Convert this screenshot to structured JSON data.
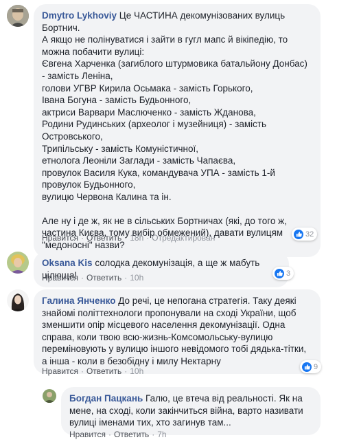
{
  "comments": [
    {
      "author": "Dmytro Lykhoviy",
      "paragraphs": [
        "Це ЧАСТИНА декомунізованих вулиць Бортнич.\nА якщо не полінуватися і зайти в гугл мапс й вікіпедію, то можна побачити вулиці:\nЄвгена Харченка (загиблого штурмовика батальйону Донбас) - замість Леніна,\nголови УГВР Кирила Осьмака - замість Горького,\nІвана Богуна - замість Будьонного,\nактриси Варвари Маслюченко - замість Жданова,\nРодини Рудинських (археолог і музейниця) - замість Островського,\nТрипільську - замість Комуністичної,\nетнолога Леоніли Заглади - замість Чапаєва,\nпровулок Василя Кука, командувача УПА - замість 1-й провулок Будьонного,\nвулицю Червона Калина та ін.",
        "Але ну і де ж, як не в сільських Бортничах (які, до того ж, частина Києва, тому вибір обмежений), давати вулицям \"медоносні\" назви?"
      ],
      "reactions_count": "32",
      "actions": {
        "like": "Нравится",
        "reply": "Ответить",
        "time": "18h",
        "edited": "Отредактирован"
      }
    },
    {
      "author": "Oksana Kis",
      "paragraphs": [
        "солодка декомунізація, а ще ж мабуть цілюща!"
      ],
      "reactions_count": "3",
      "actions": {
        "like": "Нравится",
        "reply": "Ответить",
        "time": "10h"
      }
    },
    {
      "author": "Галина Янченко",
      "paragraphs": [
        "До речі, це непогана стратегія. Таку деякі знайомі політтехнологи пропонували на сході України, щоб зменшити опір місцевого населення декомунізації. Одна справа, коли твою всю-жизнь-Комсомольську-вулицю переміновують у вулицю іншого невідомого тобі дядька-тітки, а інша - коли в безобідну і милу Нектарну"
      ],
      "reactions_count": "9",
      "actions": {
        "like": "Нравится",
        "reply": "Ответить",
        "time": "10h"
      }
    },
    {
      "author": "Богдан Пацкань",
      "paragraphs": [
        "Галю, це втеча від реальності. Як на мене, на сході, коли закінчиться війна, варто називати вулиці іменами тих, хто загинув там..."
      ],
      "actions": {
        "like": "Нравится",
        "reply": "Ответить",
        "time": "7h"
      }
    }
  ],
  "colors": {
    "author": "#385898",
    "bubble": "#f2f3f5",
    "like_blue": "#1877f2"
  }
}
